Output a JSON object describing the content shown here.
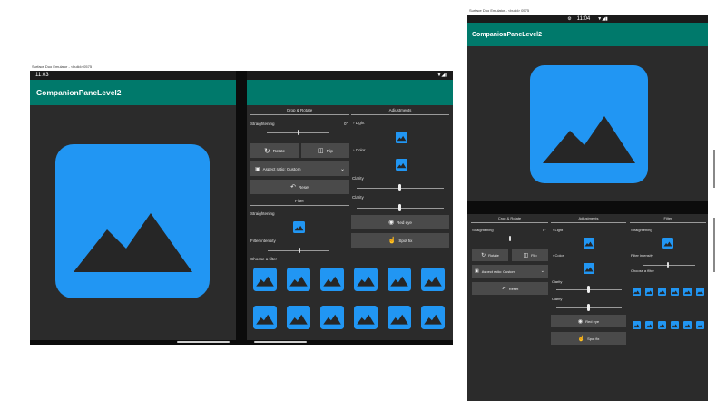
{
  "emulator_title": "Surface Duo Emulator - <build> 0575",
  "left_device": {
    "time": "11:03",
    "app_title": "CompanionPaneLevel2",
    "sections": {
      "crop_rotate": "Crop & Rotate",
      "adjustments": "Adjustments",
      "filter": "Filter"
    },
    "straightening_label": "Straightening",
    "straightening_value": "0°",
    "rotate_label": "Rotate",
    "flip_label": "Flip",
    "aspect_ratio_label": "Aspect ratio: Custom",
    "reset_label": "Reset",
    "filter_straightening_label": "Straightening",
    "filter_intensity_label": "Filter intensity",
    "choose_filter_label": "Choose a filter",
    "light_label": "Light",
    "color_label": "Color",
    "clarity_label_1": "Clarity",
    "clarity_label_2": "Clarity",
    "red_eye_label": "Red eye",
    "spot_fix_label": "Spot fix"
  },
  "right_device": {
    "time": "11:04",
    "app_title": "CompanionPaneLevel2",
    "sections": {
      "crop_rotate": "Crop & Rotate",
      "adjustments": "Adjustments",
      "filter": "Filter"
    },
    "straightening_label": "Straightening",
    "straightening_value": "0°",
    "rotate_label": "Rotate",
    "flip_label": "Flip",
    "aspect_ratio_label": "Aspect ratio: Custom",
    "reset_label": "Reset",
    "light_label": "Light",
    "color_label": "Color",
    "clarity_label_1": "Clarity",
    "clarity_label_2": "Clarity",
    "red_eye_label": "Red eye",
    "spot_fix_label": "Spot fix",
    "filter_straightening_label": "Straightening",
    "filter_intensity_label": "Filter intensity",
    "choose_filter_label": "Choose a filter"
  },
  "colors": {
    "app_bar": "#00796b",
    "accent_blue": "#2196f3",
    "panel_bg": "#2b2b2b",
    "status_bar": "#1b1b1b"
  }
}
